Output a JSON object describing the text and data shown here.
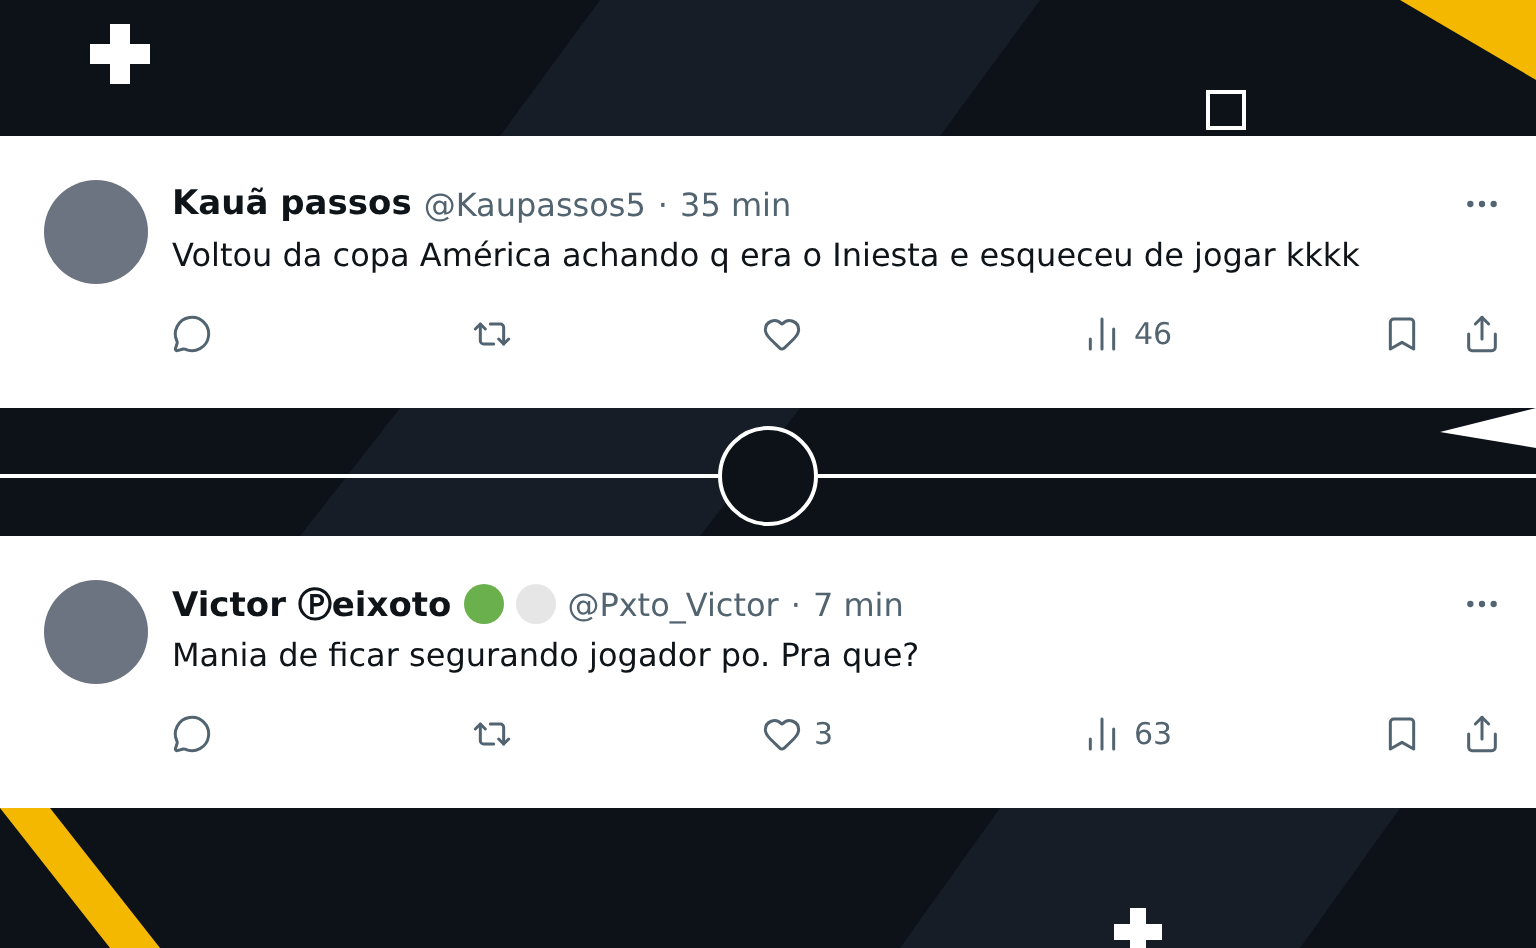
{
  "posts": [
    {
      "name": "Kauã passos",
      "handle": "@Kaupassos5",
      "time": "35 min",
      "text": "Voltou da copa América achando q era o Iniesta e esqueceu de jogar kkkk",
      "views": "46"
    },
    {
      "name": "Victor Ⓟeixoto",
      "handle": "@Pxto_Victor",
      "time": "7 min",
      "badges": [
        {
          "color": "#6ab04c"
        },
        {
          "color": "#e6e6e6"
        }
      ],
      "text": "Mania de ficar segurando jogador po. Pra que?",
      "likes": "3",
      "views": "63"
    }
  ],
  "separator": "·"
}
